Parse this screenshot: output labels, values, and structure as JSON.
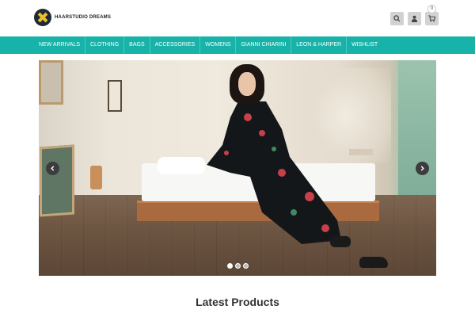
{
  "brand": {
    "name": "HAARSTUDIO DREAMS",
    "logo_icon": "x-logo-icon",
    "logo_accent": "#e9c02b",
    "logo_bg": "#1f2a36"
  },
  "header": {
    "icons": [
      {
        "name": "search-icon"
      },
      {
        "name": "user-icon"
      },
      {
        "name": "cart-icon"
      }
    ],
    "cart_count": "0"
  },
  "nav": {
    "accent": "#17b3a9",
    "items": [
      {
        "label": "NEW ARRIVALS"
      },
      {
        "label": "CLOTHING"
      },
      {
        "label": "BAGS"
      },
      {
        "label": "ACCESSORIES"
      },
      {
        "label": "WOMENS"
      },
      {
        "label": "GIANNI CHIARINI"
      },
      {
        "label": "LEON & HARPER"
      },
      {
        "label": "WISHLIST"
      }
    ]
  },
  "hero": {
    "prev_icon": "chevron-left-icon",
    "next_icon": "chevron-right-icon",
    "slide_count": 3,
    "active_slide": 1
  },
  "section": {
    "title": "Latest Products"
  }
}
